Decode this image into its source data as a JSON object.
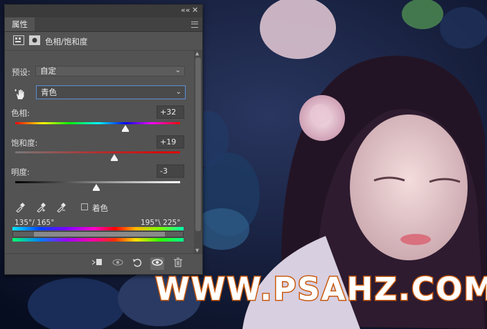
{
  "panel": {
    "tab_label": "属性",
    "collapse_glyph": "««",
    "close_glyph": "✕",
    "adjustment_title": "色相/饱和度",
    "preset_label": "预设:",
    "preset_value": "自定",
    "channel_value": "青色",
    "hue": {
      "label": "色相:",
      "value": "+32",
      "level": 0.67
    },
    "saturation": {
      "label": "饱和度:",
      "value": "+19",
      "level": 0.6
    },
    "lightness": {
      "label": "明度:",
      "value": "-3",
      "level": 0.49
    },
    "colorize_label": "着色",
    "colorize_checked": false,
    "range_left": "135°/ 165°",
    "range_right": "195°\\ 225°",
    "footer_icons": [
      "clip-to-layer-icon",
      "view-previous-icon",
      "reset-icon",
      "visibility-eye-icon",
      "trash-icon"
    ]
  },
  "watermark": {
    "text": "WWW.PSAHZ.COM",
    "fill": "#ffffff",
    "stroke": "#c85a10"
  },
  "colors": {
    "panel_bg": "#535353",
    "focus_border": "#5d8fd6"
  }
}
